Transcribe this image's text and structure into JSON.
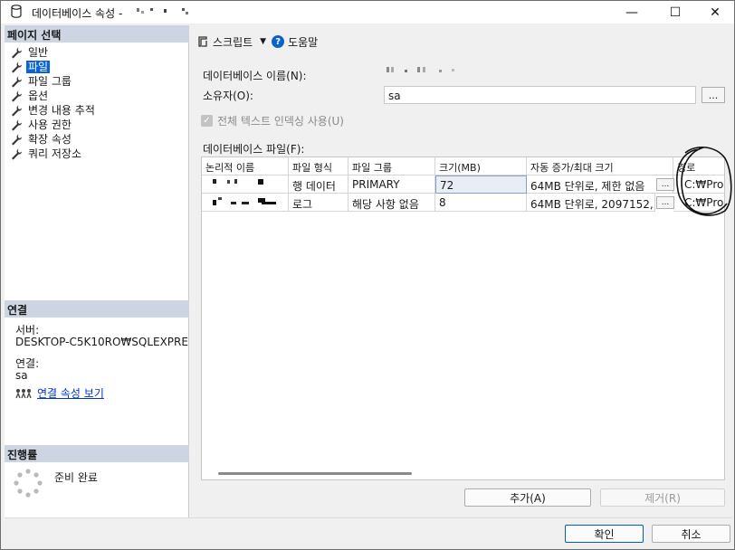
{
  "window": {
    "title": "데이터베이스 속성 -",
    "controls": {
      "minimize": "—",
      "maximize": "☐",
      "close": "✕"
    }
  },
  "left_panel": {
    "header_pages": "페이지 선택",
    "pages": [
      {
        "label": "일반",
        "selected": false
      },
      {
        "label": "파일",
        "selected": true
      },
      {
        "label": "파일 그룹",
        "selected": false
      },
      {
        "label": "옵션",
        "selected": false
      },
      {
        "label": "변경 내용 추적",
        "selected": false
      },
      {
        "label": "사용 권한",
        "selected": false
      },
      {
        "label": "확장 속성",
        "selected": false
      },
      {
        "label": "쿼리 저장소",
        "selected": false
      }
    ],
    "header_connection": "연결",
    "server_label": "서버:",
    "server_value": "DESKTOP-C5K10RO₩SQLEXPRE",
    "connection_label": "연결:",
    "connection_value": "sa",
    "view_props_link": "연결 속성 보기",
    "header_progress": "진행률",
    "progress_status": "준비 완료"
  },
  "toolbar": {
    "script_label": "스크립트",
    "help_label": "도움말"
  },
  "form": {
    "db_name_label": "데이터베이스 이름(N):",
    "owner_label": "소유자(O):",
    "owner_value": "sa",
    "ellipsis": "...",
    "fulltext_label": "전체 텍스트 인덱싱 사용(U)",
    "fulltext_checked": true,
    "files_label": "데이터베이스 파일(F):"
  },
  "grid": {
    "columns": [
      "논리적 이름",
      "파일 형식",
      "파일 그룹",
      "크기(MB)",
      "자동 증가/최대 크기",
      "경로"
    ],
    "rows": [
      {
        "type": "행 데이터",
        "group": "PRIMARY",
        "size": "72",
        "growth": "64MB 단위로, 제한 없음",
        "path": "C:₩Prog"
      },
      {
        "type": "로그",
        "group": "해당 사항 없음",
        "size": "8",
        "growth": "64MB 단위로, 2097152,...",
        "path": "C:₩Prog"
      }
    ]
  },
  "buttons": {
    "add": "추가(A)",
    "remove": "제거(R)",
    "ok": "확인",
    "cancel": "취소"
  },
  "colors": {
    "selection": "#0a64d8",
    "section_header": "#cdd5e2",
    "link": "#0033cc",
    "primary_border": "#005fb8"
  }
}
